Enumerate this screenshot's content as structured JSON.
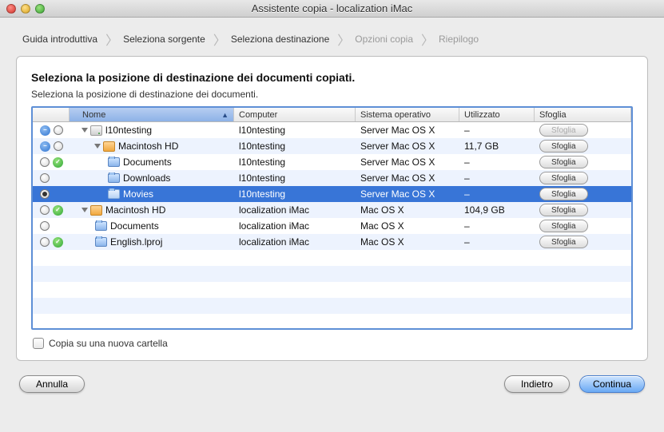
{
  "window": {
    "title": "Assistente copia - localization iMac"
  },
  "crumbs": {
    "c1": "Guida introduttiva",
    "c2": "Seleziona sorgente",
    "c3": "Seleziona destinazione",
    "c4": "Opzioni copia",
    "c5": "Riepilogo"
  },
  "heading": "Seleziona la posizione di destinazione dei documenti copiati.",
  "subheading": "Seleziona la posizione di destinazione dei documenti.",
  "columns": {
    "name": "Nome",
    "computer": "Computer",
    "os": "Sistema operativo",
    "used": "Utilizzato",
    "browse": "Sfoglia"
  },
  "browse_label": "Sfoglia",
  "rows": {
    "r0": {
      "name": "l10ntesting",
      "computer": "l10ntesting",
      "os": "Server Mac OS X",
      "used": "–"
    },
    "r1": {
      "name": "Macintosh HD",
      "computer": "l10ntesting",
      "os": "Server Mac OS X",
      "used": "11,7 GB"
    },
    "r2": {
      "name": "Documents",
      "computer": "l10ntesting",
      "os": "Server Mac OS X",
      "used": "–"
    },
    "r3": {
      "name": "Downloads",
      "computer": "l10ntesting",
      "os": "Server Mac OS X",
      "used": "–"
    },
    "r4": {
      "name": "Movies",
      "computer": "l10ntesting",
      "os": "Server Mac OS X",
      "used": "–"
    },
    "r5": {
      "name": "Macintosh HD",
      "computer": "localization iMac",
      "os": "Mac OS X",
      "used": "104,9 GB"
    },
    "r6": {
      "name": "Documents",
      "computer": "localization iMac",
      "os": "Mac OS X",
      "used": "–"
    },
    "r7": {
      "name": "English.lproj",
      "computer": "localization iMac",
      "os": "Mac OS X",
      "used": "–"
    }
  },
  "copy_checkbox": "Copia su una nuova cartella",
  "buttons": {
    "cancel": "Annulla",
    "back": "Indietro",
    "continue": "Continua"
  }
}
